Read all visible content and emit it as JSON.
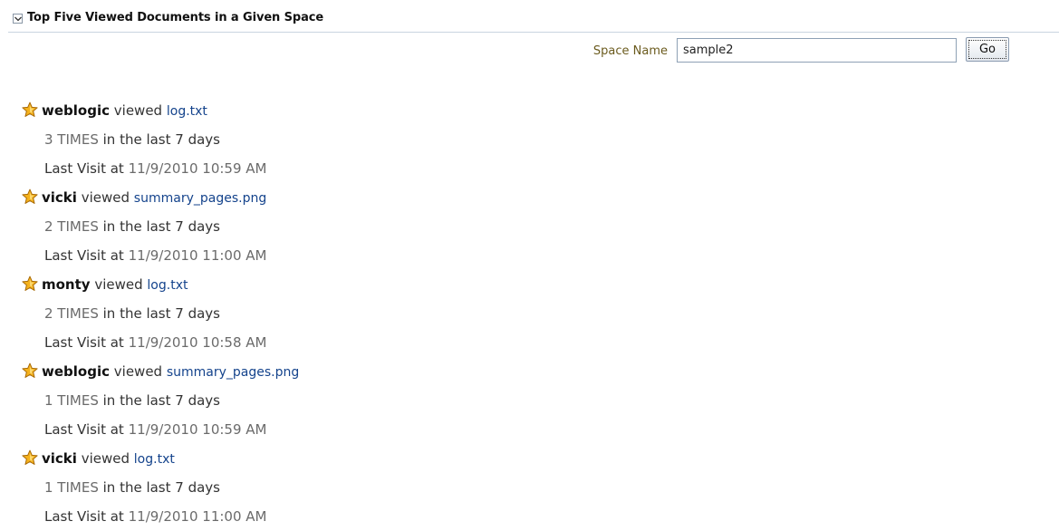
{
  "panel": {
    "title": "Top Five Viewed Documents in a Given Space"
  },
  "search": {
    "label": "Space Name",
    "value": "sample2",
    "go_label": "Go"
  },
  "entries": [
    {
      "user": "weblogic",
      "verb": "viewed",
      "document": "log.txt",
      "count": "3 TIMES",
      "period": "in the last 7 days",
      "visit_prefix": "Last Visit at",
      "visit_time": "11/9/2010 10:59 AM"
    },
    {
      "user": "vicki",
      "verb": "viewed",
      "document": "summary_pages.png",
      "count": "2 TIMES",
      "period": "in the last 7 days",
      "visit_prefix": "Last Visit at",
      "visit_time": "11/9/2010 11:00 AM"
    },
    {
      "user": "monty",
      "verb": "viewed",
      "document": "log.txt",
      "count": "2 TIMES",
      "period": "in the last 7 days",
      "visit_prefix": "Last Visit at",
      "visit_time": "11/9/2010 10:58 AM"
    },
    {
      "user": "weblogic",
      "verb": "viewed",
      "document": "summary_pages.png",
      "count": "1 TIMES",
      "period": "in the last 7 days",
      "visit_prefix": "Last Visit at",
      "visit_time": "11/9/2010 10:59 AM"
    },
    {
      "user": "vicki",
      "verb": "viewed",
      "document": "log.txt",
      "count": "1 TIMES",
      "period": "in the last 7 days",
      "visit_prefix": "Last Visit at",
      "visit_time": "11/9/2010 11:00 AM"
    }
  ],
  "icons": {
    "star": "star-icon",
    "collapse": "chevron-down-icon"
  },
  "colors": {
    "link": "#14438c",
    "star_fill": "#f5b21c",
    "label": "#6b5b1e"
  }
}
